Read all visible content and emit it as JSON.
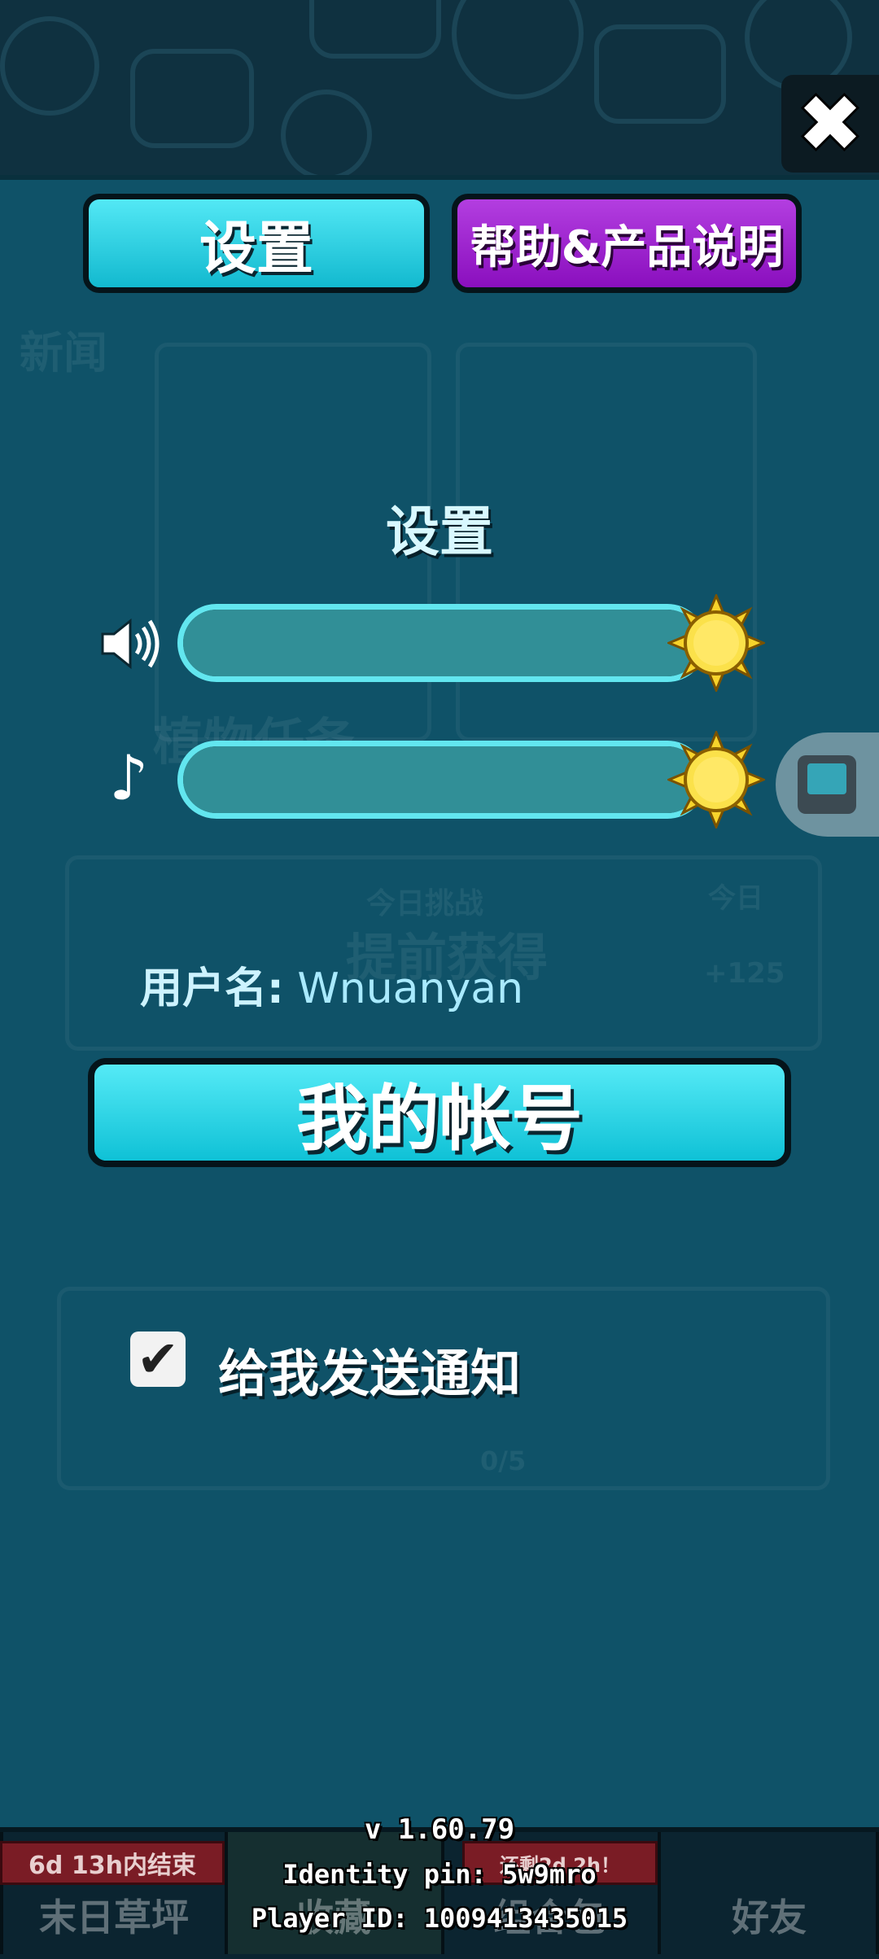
{
  "header": {
    "close_icon": "close-icon"
  },
  "tabs": [
    {
      "label": "设置",
      "active": true,
      "color": "#1fc8dc"
    },
    {
      "label": "帮助&产品说明",
      "active": false,
      "color": "#9a1ccc"
    }
  ],
  "background_text": {
    "news": "新闻",
    "plant_quest": "植物任务",
    "today_challenge": "今日挑战",
    "early_get": "提前获得",
    "today": "今日",
    "reward": "+125",
    "progress": "0/5"
  },
  "settings": {
    "title": "设置",
    "sound": {
      "icon": "speaker-icon",
      "level": 1.0
    },
    "music": {
      "icon": "music-note-icon",
      "level": 1.0
    },
    "username_label": "用户名:",
    "username_value": "Wnuanyan",
    "account_button": "我的帐号",
    "notifications": {
      "label": "给我发送通知",
      "checked": true
    }
  },
  "bottom_nav": {
    "items": [
      "末日草坪",
      "收藏",
      "组合包",
      "好友"
    ],
    "banner_left": "6d 13h内结束",
    "banner_right": "还剩2d 2h！"
  },
  "footer": {
    "version": "v 1.60.79",
    "identity_pin": "Identity pin: 5w9mro",
    "player_id": "Player ID: 1009413435015"
  }
}
